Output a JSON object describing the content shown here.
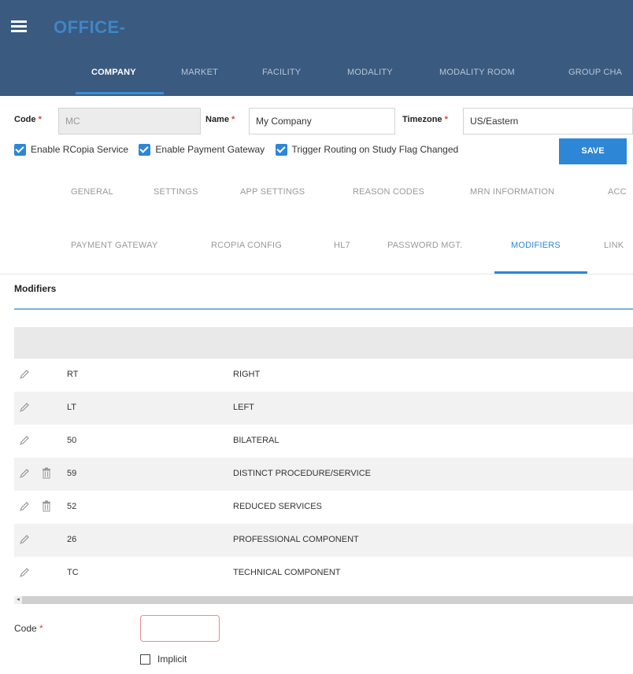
{
  "header": {
    "app_title": "OFFICE-",
    "nav": [
      {
        "label": "COMPANY",
        "active": true
      },
      {
        "label": "MARKET",
        "active": false
      },
      {
        "label": "FACILITY",
        "active": false
      },
      {
        "label": "MODALITY",
        "active": false
      },
      {
        "label": "MODALITY ROOM",
        "active": false
      },
      {
        "label": "GROUP CHA",
        "active": false
      }
    ]
  },
  "form": {
    "code_label": "Code",
    "code_value": "MC",
    "name_label": "Name",
    "name_value": "My Company",
    "timezone_label": "Timezone",
    "timezone_value": "US/Eastern",
    "required_mark": "*",
    "checkboxes": [
      {
        "label": "Enable RCopia Service",
        "checked": true
      },
      {
        "label": "Enable Payment Gateway",
        "checked": true
      },
      {
        "label": "Trigger Routing on Study Flag Changed",
        "checked": true
      }
    ],
    "save_label": "SAVE"
  },
  "tabs_row1": [
    "GENERAL",
    "SETTINGS",
    "APP SETTINGS",
    "REASON CODES",
    "MRN INFORMATION",
    "ACC"
  ],
  "tabs_row2": [
    "PAYMENT GATEWAY",
    "RCOPIA CONFIG",
    "HL7",
    "PASSWORD MGT.",
    "MODIFIERS",
    "LINK"
  ],
  "active_tab": "MODIFIERS",
  "section": {
    "title": "Modifiers"
  },
  "modifiers": [
    {
      "code": "RT",
      "description": "RIGHT",
      "deletable": false
    },
    {
      "code": "LT",
      "description": "LEFT",
      "deletable": false
    },
    {
      "code": "50",
      "description": "BILATERAL",
      "deletable": false
    },
    {
      "code": "59",
      "description": "DISTINCT PROCEDURE/SERVICE",
      "deletable": true
    },
    {
      "code": "52",
      "description": "REDUCED SERVICES",
      "deletable": true
    },
    {
      "code": "26",
      "description": "PROFESSIONAL COMPONENT",
      "deletable": false
    },
    {
      "code": "TC",
      "description": "TECHNICAL COMPONENT",
      "deletable": false
    }
  ],
  "new_modifier": {
    "code_label": "Code",
    "required_mark": "*",
    "code_value": "",
    "implicit_label": "Implicit",
    "implicit_checked": false
  },
  "colors": {
    "header_bg": "#3a5a80",
    "accent": "#2e86d6",
    "required": "#e03c3c"
  }
}
